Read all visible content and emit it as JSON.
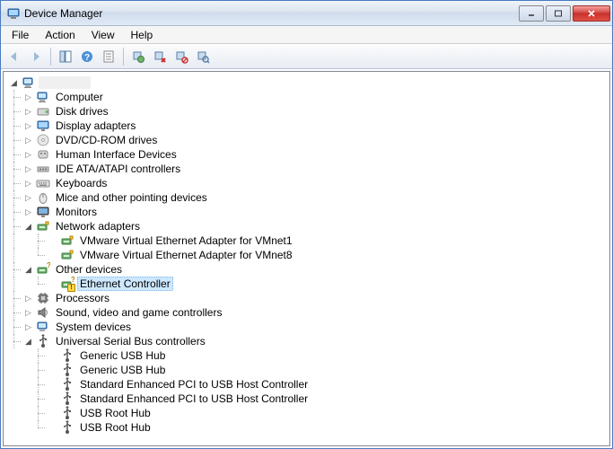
{
  "window": {
    "title": "Device Manager"
  },
  "menu": {
    "file": "File",
    "action": "Action",
    "view": "View",
    "help": "Help"
  },
  "toolbar_tips": {
    "back": "Back",
    "forward": "Forward",
    "show_hide": "Show/Hide Console Tree",
    "help": "Help",
    "properties": "Properties",
    "update": "Update Driver Software",
    "uninstall": "Uninstall",
    "disable": "Disable",
    "scan": "Scan for hardware changes"
  },
  "tree": {
    "root": "",
    "nodes": [
      {
        "label": "Computer",
        "icon": "computer",
        "expand": "collapsed"
      },
      {
        "label": "Disk drives",
        "icon": "disk",
        "expand": "collapsed"
      },
      {
        "label": "Display adapters",
        "icon": "display",
        "expand": "collapsed"
      },
      {
        "label": "DVD/CD-ROM drives",
        "icon": "dvd",
        "expand": "collapsed"
      },
      {
        "label": "Human Interface Devices",
        "icon": "hid",
        "expand": "collapsed"
      },
      {
        "label": "IDE ATA/ATAPI controllers",
        "icon": "ide",
        "expand": "collapsed"
      },
      {
        "label": "Keyboards",
        "icon": "keyboard",
        "expand": "collapsed"
      },
      {
        "label": "Mice and other pointing devices",
        "icon": "mouse",
        "expand": "collapsed"
      },
      {
        "label": "Monitors",
        "icon": "monitor",
        "expand": "collapsed"
      },
      {
        "label": "Network adapters",
        "icon": "network",
        "expand": "expanded",
        "children": [
          {
            "label": "VMware Virtual Ethernet Adapter for VMnet1",
            "icon": "network"
          },
          {
            "label": "VMware Virtual Ethernet Adapter for VMnet8",
            "icon": "network"
          }
        ]
      },
      {
        "label": "Other devices",
        "icon": "other",
        "expand": "expanded",
        "children": [
          {
            "label": "Ethernet Controller",
            "icon": "other",
            "warn": true,
            "selected": true
          }
        ]
      },
      {
        "label": "Processors",
        "icon": "processor",
        "expand": "collapsed"
      },
      {
        "label": "Sound, video and game controllers",
        "icon": "sound",
        "expand": "collapsed"
      },
      {
        "label": "System devices",
        "icon": "system",
        "expand": "collapsed"
      },
      {
        "label": "Universal Serial Bus controllers",
        "icon": "usb",
        "expand": "expanded",
        "children": [
          {
            "label": "Generic USB Hub",
            "icon": "usb"
          },
          {
            "label": "Generic USB Hub",
            "icon": "usb"
          },
          {
            "label": "Standard Enhanced PCI to USB Host Controller",
            "icon": "usb"
          },
          {
            "label": "Standard Enhanced PCI to USB Host Controller",
            "icon": "usb"
          },
          {
            "label": "USB Root Hub",
            "icon": "usb"
          },
          {
            "label": "USB Root Hub",
            "icon": "usb"
          }
        ]
      }
    ]
  }
}
